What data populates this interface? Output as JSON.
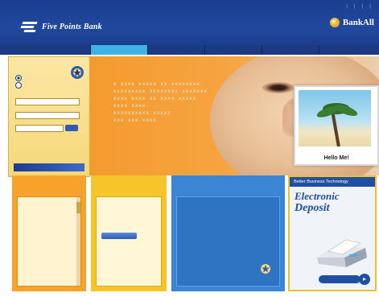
{
  "header": {
    "top_links": [
      "",
      "",
      "",
      "",
      ""
    ],
    "brand_name": "Five Points Bank",
    "partner_name": "BankAll",
    "tagline": ""
  },
  "nav": {
    "tabs": [
      {
        "label": "",
        "active": true
      },
      {
        "label": "",
        "active": false
      },
      {
        "label": "",
        "active": false
      },
      {
        "label": "",
        "active": false
      },
      {
        "label": "",
        "active": false
      }
    ]
  },
  "login": {
    "title": "",
    "radio_1": "",
    "radio_2": "",
    "field_1_label": "",
    "field_2_label": "",
    "field_3_label": "",
    "go": "",
    "promo_line_1": "",
    "promo_line_2": "",
    "promo_line_3": ""
  },
  "hero": {
    "lines": [
      "X XXXX XXXXX XX XXXXXXXX.",
      "XXXXXXXXX XXXXXXXX XXXXXXX",
      "XXXX XXXX XX XXXX XXXXX",
      "XXXX XXXX.",
      "XXXXXXXXXX XXXXX",
      "XXX-XXX-XXXX"
    ],
    "card_caption": "Hello Me!"
  },
  "panels": {
    "p1": {
      "title": "",
      "lines": [
        "",
        "",
        ""
      ],
      "link_1": "",
      "link_2": "",
      "link_3": "",
      "warning_lines": [
        "",
        "",
        "",
        ""
      ]
    },
    "p2": {
      "title": "",
      "subtitle": "",
      "lines": [
        "",
        "",
        ""
      ],
      "button": ""
    },
    "p3": {
      "title": "",
      "items": [
        {
          "label": "",
          "head": true
        },
        {
          "label": "",
          "head": true
        },
        {
          "label": "",
          "head": false
        },
        {
          "label": "",
          "head": false
        },
        {
          "label": "",
          "head": false
        },
        {
          "label": "",
          "head": false
        },
        {
          "label": "",
          "head": false
        },
        {
          "label": "",
          "head": false
        },
        {
          "label": "",
          "head": false
        },
        {
          "label": "",
          "head": false
        },
        {
          "label": "",
          "head": false
        },
        {
          "label": "",
          "head": false
        }
      ]
    },
    "p4": {
      "header": "Better Business Technology",
      "big_1": "Electronic",
      "big_2": "Deposit",
      "small": "",
      "cta": ""
    }
  }
}
